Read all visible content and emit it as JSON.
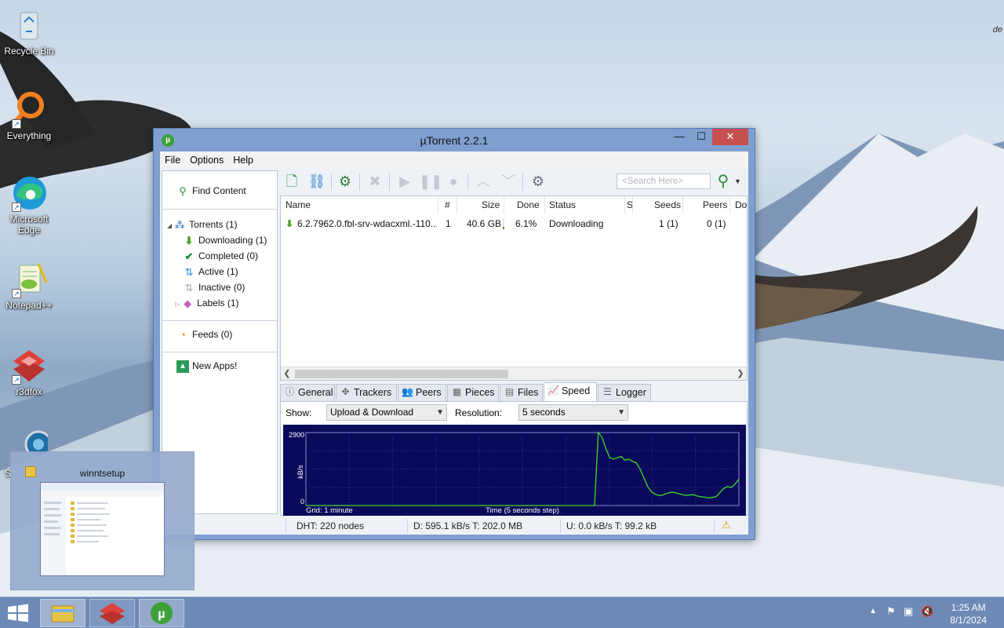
{
  "desktop": {
    "icons": [
      {
        "label": "Recycle Bin"
      },
      {
        "label": "Everything"
      },
      {
        "label": "Microsoft Edge"
      },
      {
        "label": "Notepad++"
      },
      {
        "label": "r3dfox"
      },
      {
        "label": "S"
      }
    ],
    "corner_text": "de"
  },
  "window": {
    "title": "µTorrent 2.2.1",
    "min": "—",
    "max": "☐",
    "close": "✕",
    "menu": [
      "File",
      "Options",
      "Help"
    ]
  },
  "sidebar": {
    "find_content": "Find Content",
    "torrents": "Torrents (1)",
    "downloading": "Downloading (1)",
    "completed": "Completed (0)",
    "active": "Active (1)",
    "inactive": "Inactive (0)",
    "labels": "Labels (1)",
    "feeds": "Feeds (0)",
    "new_apps": "New Apps!"
  },
  "toolbar": {
    "search_placeholder": "<Search Here>"
  },
  "list": {
    "columns": [
      "Name",
      "#",
      "Size",
      "Done",
      "Status",
      "S",
      "Seeds",
      "Peers",
      "Do"
    ],
    "rows": [
      {
        "name": "6.2.7962.0.fbl-srv-wdacxml.-110...",
        "num": "1",
        "size": "40.6 GB",
        "done": "6.1%",
        "done_fraction": 0.061,
        "status": "Downloading",
        "seeds": "1 (1)",
        "peers": "0 (1)"
      }
    ]
  },
  "tabs": [
    "General",
    "Trackers",
    "Peers",
    "Pieces",
    "Files",
    "Speed",
    "Logger"
  ],
  "speed": {
    "show_label": "Show:",
    "show_value": "Upload & Download",
    "resolution_label": "Resolution:",
    "resolution_value": "5 seconds",
    "y_max": "2900",
    "y_min": "0",
    "y_unit": "kB/s",
    "grid_label": "Grid: 1 minute",
    "time_label": "Time (5 seconds step)",
    "download_series": [
      0,
      0,
      0,
      0,
      0,
      0,
      0,
      0,
      0,
      0,
      0,
      0,
      0,
      0,
      0,
      0,
      0,
      0,
      0,
      0,
      0,
      0,
      0,
      0,
      0,
      0,
      0,
      0,
      0,
      0,
      0,
      0,
      0,
      0,
      0,
      0,
      0,
      0,
      0,
      0,
      0,
      0,
      0,
      0,
      0,
      0,
      0,
      0,
      0,
      0,
      0,
      0,
      0,
      0,
      0,
      0,
      0,
      0,
      0,
      0,
      0,
      0,
      0,
      0,
      0,
      0,
      0,
      0,
      0,
      0,
      0,
      0,
      0,
      0,
      0,
      0,
      0,
      2900,
      2700,
      2250,
      1900,
      1850,
      1900,
      1950,
      1800,
      1850,
      1750,
      1700,
      1450,
      1100,
      750,
      550,
      450,
      400,
      420,
      480,
      520,
      520,
      480,
      440,
      400,
      420,
      430,
      380,
      350,
      330,
      300,
      320,
      350,
      520,
      680,
      750,
      720,
      850,
      1050
    ]
  },
  "status": {
    "dht": "DHT: 220 nodes",
    "down": "D: 595.1 kB/s T: 202.0 MB",
    "up": "U: 0.0 kB/s T: 99.2 kB"
  },
  "preview": {
    "title": "winntsetup"
  },
  "clock": {
    "time": "1:25 AM",
    "date": "8/1/2024"
  }
}
